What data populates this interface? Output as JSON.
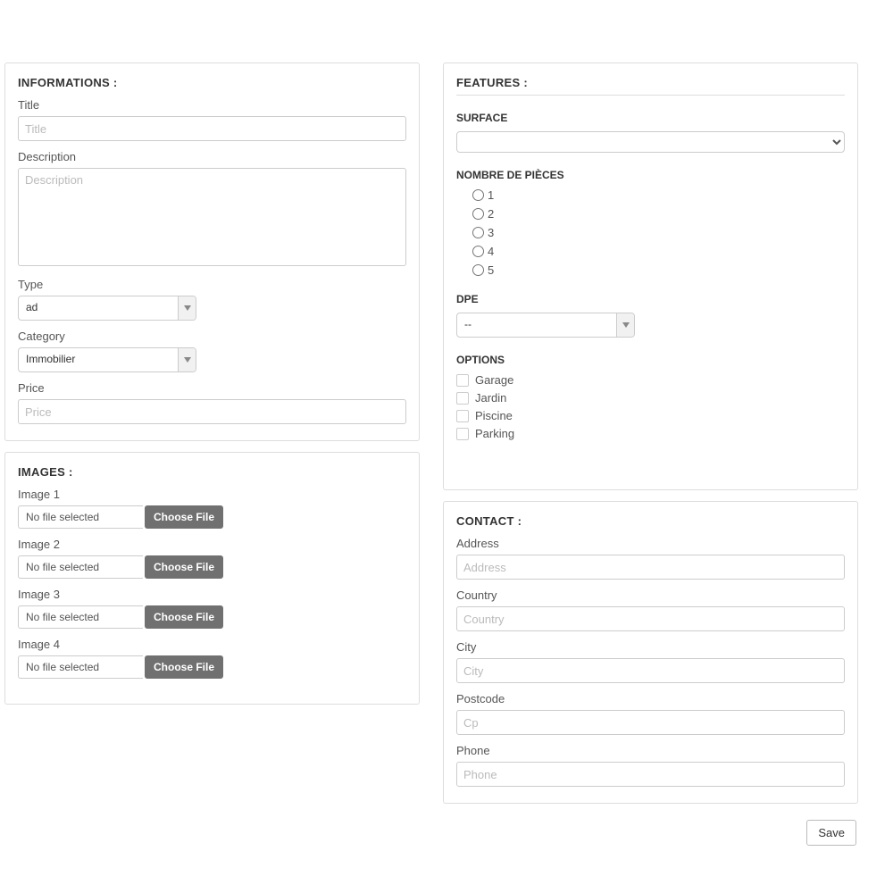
{
  "informations": {
    "heading": "Informations :",
    "title_label": "Title",
    "title_placeholder": "Title",
    "desc_label": "Description",
    "desc_placeholder": "Description",
    "type_label": "Type",
    "type_value": "ad",
    "category_label": "Category",
    "category_value": "Immobilier",
    "price_label": "Price",
    "price_placeholder": "Price"
  },
  "images": {
    "heading": "Images :",
    "no_file": "No file selected",
    "choose_file": "Choose File",
    "items": [
      {
        "label": "Image 1"
      },
      {
        "label": "Image 2"
      },
      {
        "label": "Image 3"
      },
      {
        "label": "Image 4"
      }
    ]
  },
  "features": {
    "heading": "Features :",
    "surface_label": "Surface",
    "surface_value": "",
    "rooms_label": "Nombre de pièces",
    "rooms_options": [
      "1",
      "2",
      "3",
      "4",
      "5"
    ],
    "dpe_label": "DPE",
    "dpe_value": "--",
    "options_label": "Options",
    "options": [
      "Garage",
      "Jardin",
      "Piscine",
      "Parking"
    ]
  },
  "contact": {
    "heading": "Contact :",
    "address_label": "Address",
    "address_placeholder": "Address",
    "country_label": "Country",
    "country_placeholder": "Country",
    "city_label": "City",
    "city_placeholder": "City",
    "postcode_label": "Postcode",
    "postcode_placeholder": "Cp",
    "phone_label": "Phone",
    "phone_placeholder": "Phone"
  },
  "save_label": "Save"
}
